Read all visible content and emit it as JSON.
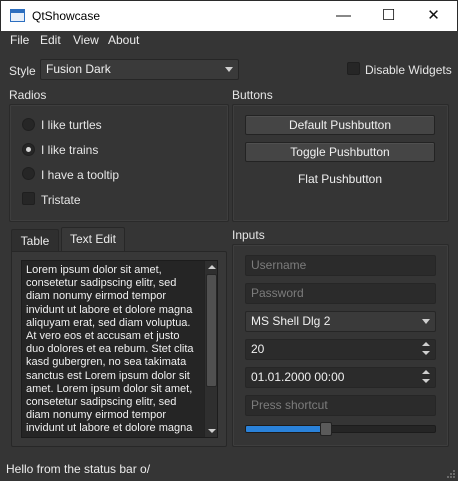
{
  "window": {
    "title": "QtShowcase",
    "minimize_glyph": "—",
    "maximize_glyph": "☐",
    "close_glyph": "✕"
  },
  "menu": [
    "File",
    "Edit",
    "View",
    "About"
  ],
  "style_row": {
    "label": "Style",
    "selected": "Fusion Dark",
    "disable_widgets_label": "Disable Widgets",
    "disable_widgets_checked": false
  },
  "radios": {
    "title": "Radios",
    "items": [
      {
        "label": "I like turtles",
        "checked": false
      },
      {
        "label": "I like trains",
        "checked": true
      },
      {
        "label": "I have a tooltip",
        "checked": false
      }
    ],
    "tristate_label": "Tristate"
  },
  "buttons": {
    "title": "Buttons",
    "default_label": "Default Pushbutton",
    "toggle_label": "Toggle Pushbutton",
    "flat_label": "Flat Pushbutton"
  },
  "tabs": {
    "items": [
      {
        "label": "Table",
        "active": false
      },
      {
        "label": "Text Edit",
        "active": true
      }
    ],
    "text_edit_content": "Lorem ipsum dolor sit amet,\nconsetetur sadipscing elitr, sed\ndiam nonumy eirmod tempor\ninvidunt ut labore et dolore magna\naliquyam erat, sed diam voluptua.\nAt vero eos et accusam et justo\nduo dolores et ea rebum. Stet clita\nkasd gubergren, no sea takimata\nsanctus est Lorem ipsum dolor sit\namet. Lorem ipsum dolor sit amet,\nconsetetur sadipscing elitr, sed\ndiam nonumy eirmod tempor\ninvidunt ut labore et dolore magna\naliquyam erat, sed diam voluptua."
  },
  "inputs": {
    "title": "Inputs",
    "username_placeholder": "Username",
    "password_placeholder": "Password",
    "font_combo": "MS Shell Dlg 2",
    "spin_value": "20",
    "datetime_value": "01.01.2000 00:00",
    "shortcut_placeholder": "Press shortcut",
    "slider_fraction": 0.42
  },
  "status_bar": "Hello from the status bar o/",
  "colors": {
    "accent": "#2a82da",
    "window_bg": "#353535",
    "base": "#2b2b2b"
  }
}
